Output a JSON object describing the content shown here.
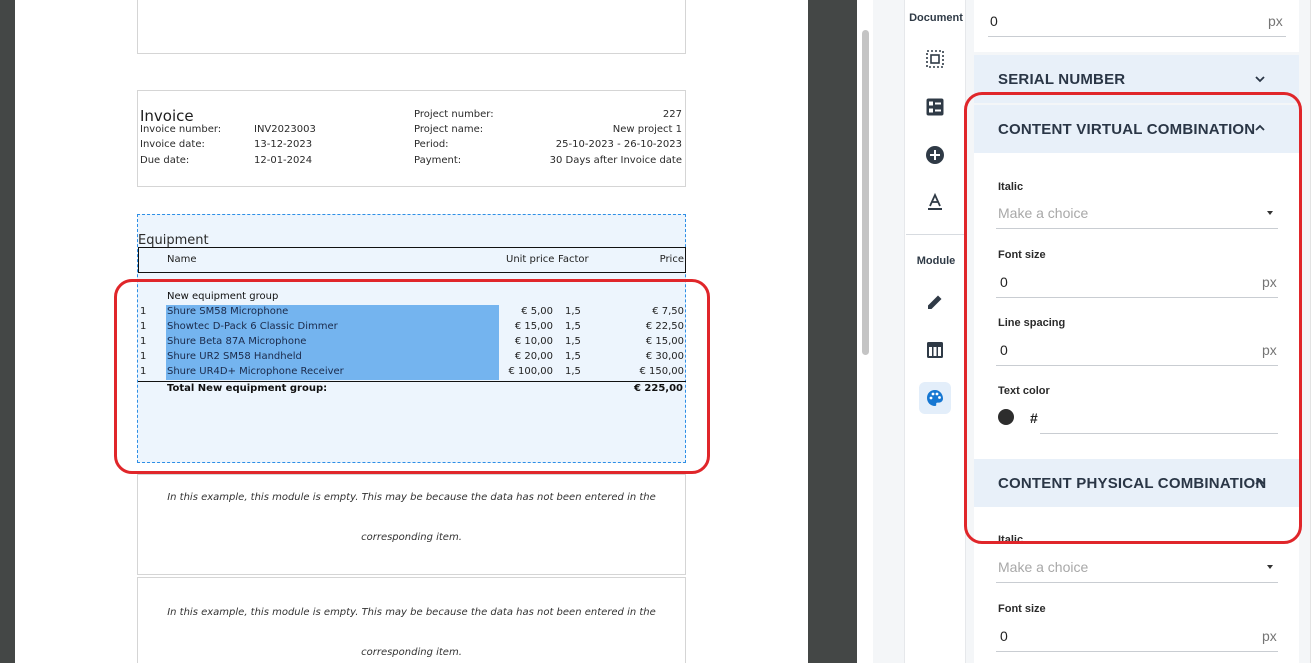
{
  "document": {
    "invoice": {
      "title": "Invoice",
      "left_rows": [
        {
          "label": "Invoice number:",
          "value": "INV2023003"
        },
        {
          "label": "Invoice date:",
          "value": "13-12-2023"
        },
        {
          "label": "Due date:",
          "value": "12-01-2024"
        }
      ],
      "right_rows": [
        {
          "label": "Project number:",
          "value": "227"
        },
        {
          "label": "Project name:",
          "value": "New project 1"
        },
        {
          "label": "Period:",
          "value": "25-10-2023 - 26-10-2023"
        },
        {
          "label": "Payment:",
          "value": "30 Days after Invoice date"
        }
      ]
    },
    "equipment": {
      "title": "Equipment",
      "columns": {
        "name": "Name",
        "unit_price": "Unit price",
        "factor": "Factor",
        "price": "Price"
      },
      "group_title": "New equipment group",
      "rows": [
        {
          "qty": "1",
          "name": "Shure SM58 Microphone",
          "unit_price": "€ 5,00",
          "factor": "1,5",
          "price": "€ 7,50"
        },
        {
          "qty": "1",
          "name": "Showtec D-Pack 6 Classic Dimmer",
          "unit_price": "€ 15,00",
          "factor": "1,5",
          "price": "€ 22,50"
        },
        {
          "qty": "1",
          "name": "Shure Beta 87A Microphone",
          "unit_price": "€ 10,00",
          "factor": "1,5",
          "price": "€ 15,00"
        },
        {
          "qty": "1",
          "name": "Shure UR2 SM58 Handheld",
          "unit_price": "€ 20,00",
          "factor": "1,5",
          "price": "€ 30,00"
        },
        {
          "qty": "1",
          "name": "Shure UR4D+ Microphone Receiver",
          "unit_price": "€ 100,00",
          "factor": "1,5",
          "price": "€ 150,00"
        }
      ],
      "total_label": "Total New equipment group:",
      "total_value": "€ 225,00"
    },
    "empty_text_line1": "In this example, this module is empty. This may be because the data has not been entered in the",
    "empty_text_line2": "corresponding item."
  },
  "tools": {
    "document_label": "Document",
    "module_label": "Module",
    "document_icons": [
      "select-frame-icon",
      "checklist-icon",
      "add-circle-icon",
      "text-color-icon"
    ],
    "module_icons": [
      "pencil-icon",
      "table-layout-icon",
      "palette-icon"
    ]
  },
  "panel": {
    "top_field": {
      "value": "0",
      "unit": "px"
    },
    "serial_number": {
      "title": "SERIAL NUMBER"
    },
    "content_virtual": {
      "title": "CONTENT VIRTUAL COMBINATION",
      "italic_label": "Italic",
      "italic_placeholder": "Make a choice",
      "font_size_label": "Font size",
      "font_size_value": "0",
      "font_size_unit": "px",
      "line_spacing_label": "Line spacing",
      "line_spacing_value": "0",
      "line_spacing_unit": "px",
      "text_color_label": "Text color",
      "text_color_hash": "#",
      "text_color_swatch": "#2d2d2d"
    },
    "content_physical": {
      "title": "CONTENT PHYSICAL COMBINATION",
      "italic_label": "Italic",
      "italic_placeholder": "Make a choice",
      "font_size_label": "Font size",
      "font_size_value": "0",
      "font_size_unit": "px"
    }
  },
  "colors": {
    "annotation_red": "#e0262a",
    "selection_blue": "#74b4ef",
    "active_tool_blue": "#1677d2",
    "canvas_gutter": "#444746"
  }
}
